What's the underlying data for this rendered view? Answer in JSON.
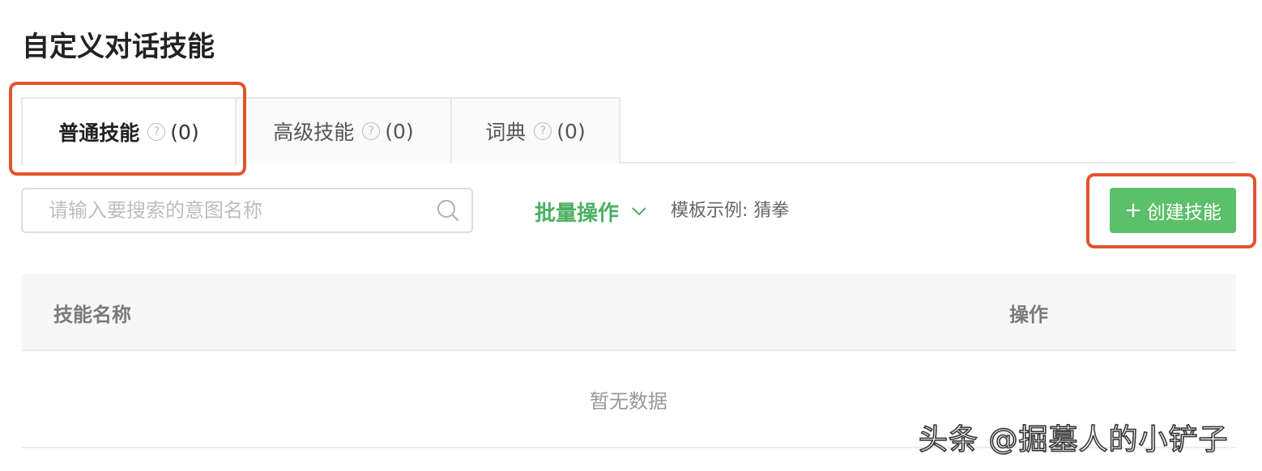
{
  "page": {
    "title": "自定义对话技能"
  },
  "tabs": [
    {
      "label": "普通技能",
      "count": "(0)",
      "active": true
    },
    {
      "label": "高级技能",
      "count": "(0)",
      "active": false
    },
    {
      "label": "词典",
      "count": "(0)",
      "active": false
    }
  ],
  "help_icon": {
    "glyph": "?",
    "icon": "question-circle-icon"
  },
  "toolbar": {
    "search_placeholder": "请输入要搜索的意图名称",
    "batch_label": "批量操作",
    "template_prefix": "模板示例: ",
    "template_link": "猜拳",
    "create_plus": "+",
    "create_label": "创建技能"
  },
  "table": {
    "columns": [
      "技能名称",
      "操作"
    ],
    "empty_text": "暂无数据"
  },
  "watermark": {
    "text": "头条 @掘墓人的小铲子"
  },
  "colors": {
    "accent_green": "#5cbf6a",
    "link_green": "#4caf63",
    "highlight_red": "#e2532e"
  }
}
